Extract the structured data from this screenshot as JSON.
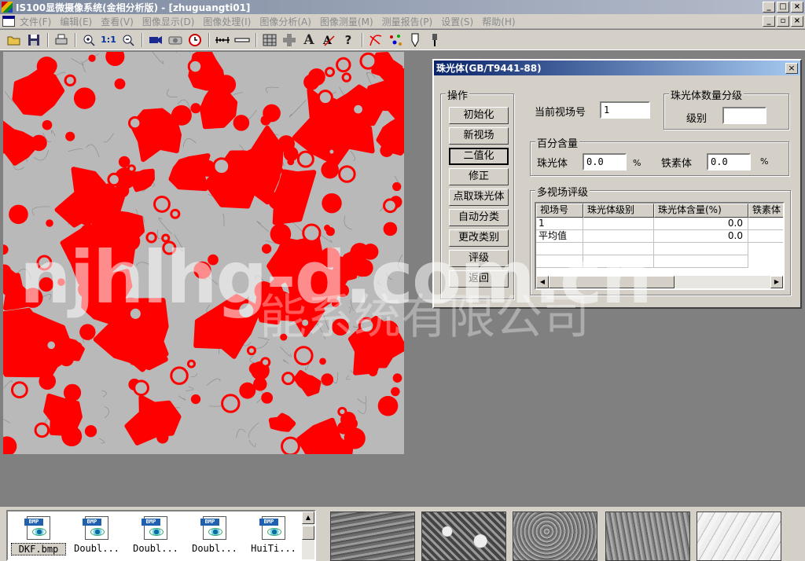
{
  "window": {
    "title": "IS100显微摄像系统(金相分析版) - [zhuguangti01]"
  },
  "menu": [
    "文件(F)",
    "编辑(E)",
    "查看(V)",
    "图像显示(D)",
    "图像处理(I)",
    "图像分析(A)",
    "图像测量(M)",
    "测量报告(P)",
    "设置(S)",
    "帮助(H)"
  ],
  "toolbar_icons": [
    "open-folder-icon",
    "save-icon",
    "print-icon",
    "zoom-in-icon",
    "actual-size-icon",
    "zoom-out-icon",
    "camera-icon",
    "capture-icon",
    "clock-icon",
    "ruler-icon",
    "measure-line-icon",
    "grain-icon",
    "cross-icon",
    "text-icon",
    "font-icon",
    "help-icon",
    "curve-icon",
    "points-icon",
    "pen-icon",
    "brush-icon"
  ],
  "toolbar_glyphs": {
    "actual_size": "1:1",
    "text": "A",
    "help": "?"
  },
  "dialog": {
    "title": "珠光体(GB/T9441-88)",
    "close": "×",
    "ops_label": "操作",
    "ops": [
      "初始化",
      "新视场",
      "二值化",
      "修正",
      "点取珠光体",
      "自动分类",
      "更改类别",
      "评级",
      "返回"
    ],
    "field_no_label": "当前视场号",
    "field_no_value": "1",
    "grade_group_label": "珠光体数量分级",
    "grade_label": "级别",
    "grade_value": "",
    "percent_group_label": "百分含量",
    "pearlite_label": "珠光体",
    "pearlite_value": "0.0",
    "ferrite_label": "铁素体",
    "ferrite_value": "0.0",
    "percent_unit": "%",
    "multi_label": "多视场评级",
    "columns": [
      "视场号",
      "珠光体级别",
      "珠光体含量(%)",
      "铁素体"
    ],
    "rows": [
      {
        "field": "1",
        "level": "",
        "content": "0.0",
        "ferrite": ""
      },
      {
        "field": "平均值",
        "level": "",
        "content": "0.0",
        "ferrite": ""
      }
    ]
  },
  "watermark": {
    "main": "njhlhg-d.com.cn",
    "sub": "能系统有限公司"
  },
  "files": [
    {
      "name": "DKF.bmp",
      "badge": "BMP"
    },
    {
      "name": "Doubl...",
      "badge": "BMP"
    },
    {
      "name": "Doubl...",
      "badge": "BMP"
    },
    {
      "name": "Doubl...",
      "badge": "BMP"
    },
    {
      "name": "HuiTi...",
      "badge": "BMP"
    }
  ],
  "colors": {
    "phase_red": "#ff0000",
    "matrix_gray": "#b9b9b9",
    "title_blue": "#0a246a"
  }
}
